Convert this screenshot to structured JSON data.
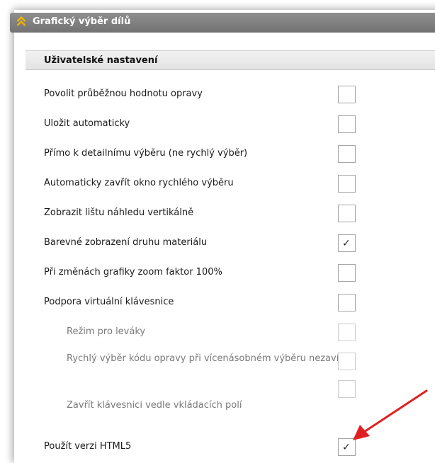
{
  "window": {
    "title": "Grafický výběr dílů",
    "collapse_icon": "double-chevron-up-icon"
  },
  "section": {
    "title": "Uživatelské nastavení"
  },
  "settings": [
    {
      "label": "Povolit průběžnou hodnotu opravy",
      "checked": false,
      "level": 0
    },
    {
      "label": "Uložit automaticky",
      "checked": false,
      "level": 0
    },
    {
      "label": "Přímo k detailnímu výběru (ne rychlý výběr)",
      "checked": false,
      "level": 0
    },
    {
      "label": "Automaticky zavřít okno rychlého výběru",
      "checked": false,
      "level": 0
    },
    {
      "label": "Zobrazit lištu náhledu vertikálně",
      "checked": false,
      "level": 0
    },
    {
      "label": "Barevné zobrazení druhu materiálu",
      "checked": true,
      "level": 0
    },
    {
      "label": "Při změnách grafiky zoom faktor 100%",
      "checked": false,
      "level": 0
    },
    {
      "label": "Podpora virtuální klávesnice",
      "checked": false,
      "level": 0
    },
    {
      "label": "Režim pro leváky",
      "checked": false,
      "level": 1
    },
    {
      "label": "Rychlý výběr kódu opravy při vícenásobném výběru nezavírat",
      "checked": false,
      "level": 1
    },
    {
      "label": "Zavřít klávesnici vedle vkládacích polí",
      "checked": false,
      "level": 1
    },
    {
      "label": "Použít verzi HTML5",
      "checked": true,
      "level": 0
    }
  ],
  "checkmark_glyph": "✓",
  "colors": {
    "accent_chevron": "#f0b400",
    "title_bar": "#7e7e7e",
    "annotation_arrow": "#e02020"
  }
}
